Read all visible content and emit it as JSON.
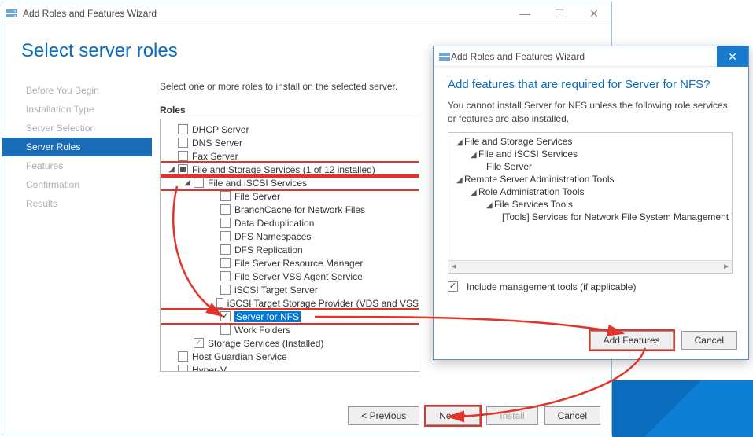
{
  "mainWindow": {
    "title": "Add Roles and Features Wizard",
    "pageHeader": "Select server roles",
    "instruction": "Select one or more roles to install on the selected server.",
    "rolesLabel": "Roles"
  },
  "sidebar": {
    "items": [
      {
        "label": "Before You Begin"
      },
      {
        "label": "Installation Type"
      },
      {
        "label": "Server Selection"
      },
      {
        "label": "Server Roles",
        "active": true
      },
      {
        "label": "Features"
      },
      {
        "label": "Confirmation"
      },
      {
        "label": "Results"
      }
    ]
  },
  "roles": [
    {
      "indent": 1,
      "label": "DHCP Server",
      "state": "unchecked"
    },
    {
      "indent": 1,
      "label": "DNS Server",
      "state": "unchecked"
    },
    {
      "indent": 1,
      "label": "Fax Server",
      "state": "unchecked"
    },
    {
      "indent": 1,
      "label": "File and Storage Services (1 of 12 installed)",
      "state": "mixed",
      "expander": "open",
      "highlight": true
    },
    {
      "indent": 2,
      "label": "File and iSCSI Services",
      "state": "unchecked",
      "expander": "open",
      "highlight": true
    },
    {
      "indent": 3,
      "label": "File Server",
      "state": "unchecked"
    },
    {
      "indent": 3,
      "label": "BranchCache for Network Files",
      "state": "unchecked"
    },
    {
      "indent": 3,
      "label": "Data Deduplication",
      "state": "unchecked"
    },
    {
      "indent": 3,
      "label": "DFS Namespaces",
      "state": "unchecked"
    },
    {
      "indent": 3,
      "label": "DFS Replication",
      "state": "unchecked"
    },
    {
      "indent": 3,
      "label": "File Server Resource Manager",
      "state": "unchecked"
    },
    {
      "indent": 3,
      "label": "File Server VSS Agent Service",
      "state": "unchecked"
    },
    {
      "indent": 3,
      "label": "iSCSI Target Server",
      "state": "unchecked"
    },
    {
      "indent": 3,
      "label": "iSCSI Target Storage Provider (VDS and VSS",
      "state": "unchecked"
    },
    {
      "indent": 3,
      "label": "Server for NFS",
      "state": "checked",
      "selected": true,
      "highlight": true
    },
    {
      "indent": 3,
      "label": "Work Folders",
      "state": "unchecked"
    },
    {
      "indent": 2,
      "label": "Storage Services (Installed)",
      "state": "checked-gray"
    },
    {
      "indent": 1,
      "label": "Host Guardian Service",
      "state": "unchecked"
    },
    {
      "indent": 1,
      "label": "Hyper-V",
      "state": "unchecked"
    }
  ],
  "bottomButtons": {
    "previous": "< Previous",
    "next": "Next >",
    "install": "Install",
    "cancel": "Cancel"
  },
  "popup": {
    "title": "Add Roles and Features Wizard",
    "heading": "Add features that are required for Server for NFS?",
    "paragraph": "You cannot install Server for NFS unless the following role services or features are also installed.",
    "includeLabel": "Include management tools (if applicable)",
    "addFeatures": "Add Features",
    "cancel": "Cancel",
    "deps": [
      {
        "indent": 1,
        "label": "File and Storage Services",
        "tri": true
      },
      {
        "indent": 2,
        "label": "File and iSCSI Services",
        "tri": true
      },
      {
        "indent": 3,
        "label": "File Server"
      },
      {
        "indent": 1,
        "label": "Remote Server Administration Tools",
        "tri": true
      },
      {
        "indent": 2,
        "label": "Role Administration Tools",
        "tri": true
      },
      {
        "indent": 3,
        "label": "File Services Tools",
        "tri": true
      },
      {
        "indent": 4,
        "label": "[Tools] Services for Network File System Management T"
      }
    ]
  }
}
